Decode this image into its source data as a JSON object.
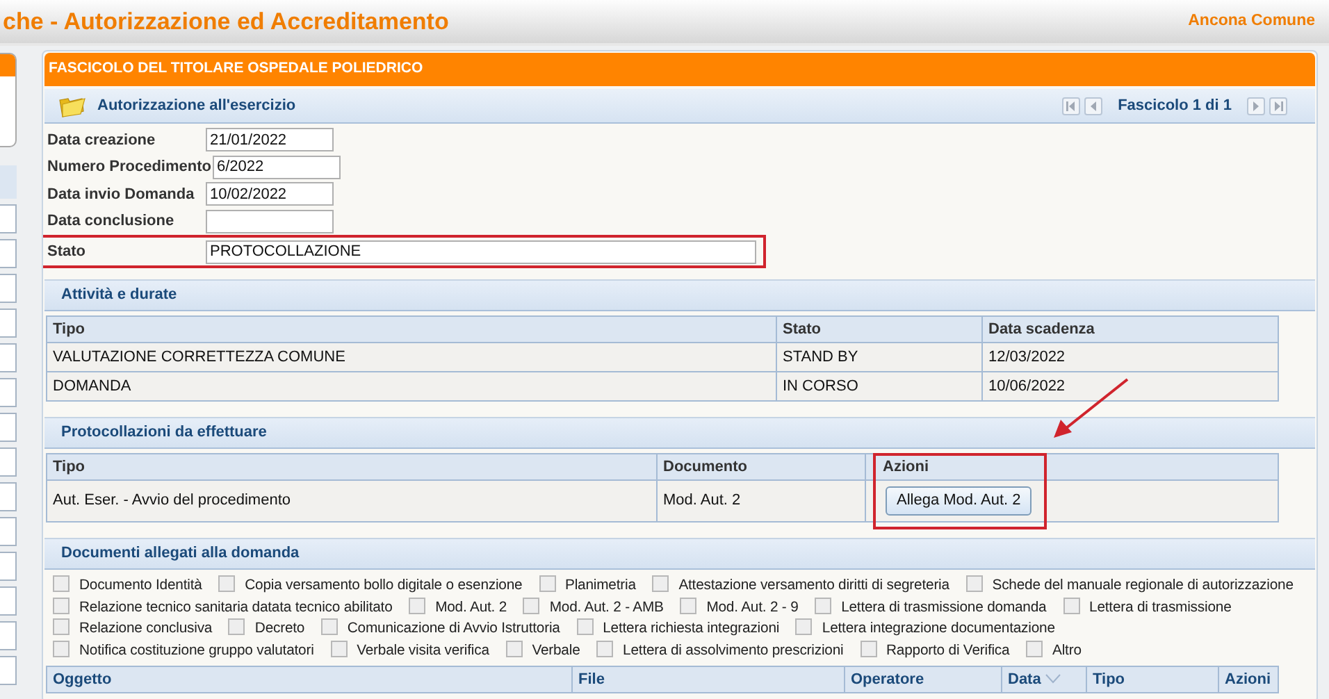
{
  "header": {
    "title": "che - Autorizzazione ed Accreditamento",
    "user": "Ancona Comune"
  },
  "fascicolo": {
    "title": "FASCICOLO DEL TITOLARE OSPEDALE POLIEDRICO",
    "subtitle": "Autorizzazione all'esercizio",
    "pager": "Fascicolo 1 di 1"
  },
  "form": [
    {
      "label": "Data creazione",
      "value": "21/01/2022",
      "kind": "short"
    },
    {
      "label": "Numero Procedimento",
      "value": "6/2022",
      "kind": "short"
    },
    {
      "label": "Data invio Domanda",
      "value": "10/02/2022",
      "kind": "short"
    },
    {
      "label": "Data conclusione",
      "kind": "short"
    },
    {
      "label": "Stato",
      "value": "PROTOCOLLAZIONE",
      "highlighted": true,
      "kind": "long"
    }
  ],
  "attivita": {
    "title": "Attività e durate",
    "columns": [
      "Tipo",
      "Stato",
      "Data scadenza"
    ],
    "rows": [
      [
        "VALUTAZIONE CORRETTEZZA COMUNE",
        "STAND BY",
        "12/03/2022"
      ],
      [
        "DOMANDA",
        "IN CORSO",
        "10/06/2022"
      ]
    ]
  },
  "protocollazioni": {
    "title": "Protocollazioni da effettuare",
    "columns": [
      {
        "label": "Tipo"
      },
      {
        "label": "Documento"
      },
      {
        "label": "Azioni",
        "highlighted": true
      }
    ],
    "rows": [
      {
        "tipo": "Aut. Eser. - Avvio del procedimento",
        "documento": "Mod. Aut. 2",
        "action": "Allega Mod. Aut. 2"
      }
    ]
  },
  "documenti": {
    "title": "Documenti allegati alla domanda",
    "items": [
      {
        "label": "Documento Identità",
        "checked": false
      },
      {
        "label": "Copia versamento bollo digitale o esenzione",
        "checked": false
      },
      {
        "label": "Planimetria",
        "checked": false
      },
      {
        "label": "Attestazione versamento diritti di segreteria",
        "checked": false
      },
      {
        "label": "Schede del manuale regionale di autorizzazione",
        "checked": false
      },
      {
        "label": "Relazione tecnico sanitaria datata tecnico abilitato",
        "checked": false
      },
      {
        "label": "Mod. Aut. 2",
        "checked": false
      },
      {
        "label": "Mod. Aut. 2 - AMB",
        "checked": false
      },
      {
        "label": "Mod. Aut. 2 - 9",
        "checked": false
      },
      {
        "label": "Lettera di trasmissione domanda",
        "checked": false
      },
      {
        "label": "Lettera di trasmissione",
        "checked": false
      },
      {
        "label": "Relazione conclusiva",
        "checked": false
      },
      {
        "label": "Decreto",
        "checked": false
      },
      {
        "label": "Comunicazione di Avvio Istruttoria",
        "checked": false
      },
      {
        "label": "Lettera richiesta integrazioni",
        "checked": false
      },
      {
        "label": "Lettera integrazione documentazione",
        "checked": false
      },
      {
        "label": "Notifica costituzione gruppo valutatori",
        "checked": false
      },
      {
        "label": "Verbale visita verifica",
        "checked": false
      },
      {
        "label": "Verbale",
        "checked": false
      },
      {
        "label": "Lettera di assolvimento prescrizioni",
        "checked": false
      },
      {
        "label": "Rapporto di Verifica",
        "checked": false
      },
      {
        "label": "Altro",
        "checked": false
      }
    ],
    "columns": [
      {
        "label": "Oggetto"
      },
      {
        "label": "File"
      },
      {
        "label": "Operatore"
      },
      {
        "label": "Data",
        "sorted": true
      },
      {
        "label": "Tipo"
      },
      {
        "label": "Azioni"
      }
    ]
  }
}
